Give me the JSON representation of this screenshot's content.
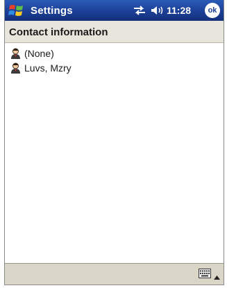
{
  "titlebar": {
    "app_title": "Settings",
    "time": "11:28",
    "ok_label": "ok",
    "start_icon": "windows-flag-icon",
    "connectivity_icon": "connectivity-icon",
    "volume_icon": "volume-icon"
  },
  "header": {
    "title": "Contact information"
  },
  "contacts": [
    {
      "label": "(None)",
      "icon": "contact-icon"
    },
    {
      "label": "Luvs, Mzry",
      "icon": "contact-icon"
    }
  ],
  "bottombar": {
    "keyboard_icon": "keyboard-icon",
    "input_menu_icon": "up-arrow-icon"
  },
  "colors": {
    "titlebar": "#1c3f96",
    "header_bg": "#e8e6dc",
    "bottombar_bg": "#d9d6c7"
  }
}
